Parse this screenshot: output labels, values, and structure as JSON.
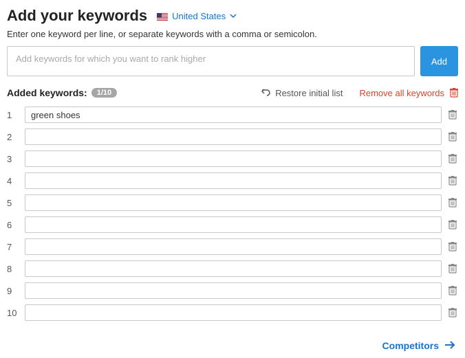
{
  "header": {
    "title": "Add your keywords",
    "country": "United States",
    "instruction": "Enter one keyword per line, or separate keywords with a comma or semicolon."
  },
  "add": {
    "placeholder": "Add keywords for which you want to rank higher",
    "button": "Add"
  },
  "added": {
    "label": "Added keywords:",
    "count": "1/10",
    "restore": "Restore initial list",
    "remove_all": "Remove all keywords"
  },
  "keywords": [
    {
      "n": "1",
      "value": "green shoes"
    },
    {
      "n": "2",
      "value": ""
    },
    {
      "n": "3",
      "value": ""
    },
    {
      "n": "4",
      "value": ""
    },
    {
      "n": "5",
      "value": ""
    },
    {
      "n": "6",
      "value": ""
    },
    {
      "n": "7",
      "value": ""
    },
    {
      "n": "8",
      "value": ""
    },
    {
      "n": "9",
      "value": ""
    },
    {
      "n": "10",
      "value": ""
    }
  ],
  "footer": {
    "competitors": "Competitors"
  }
}
